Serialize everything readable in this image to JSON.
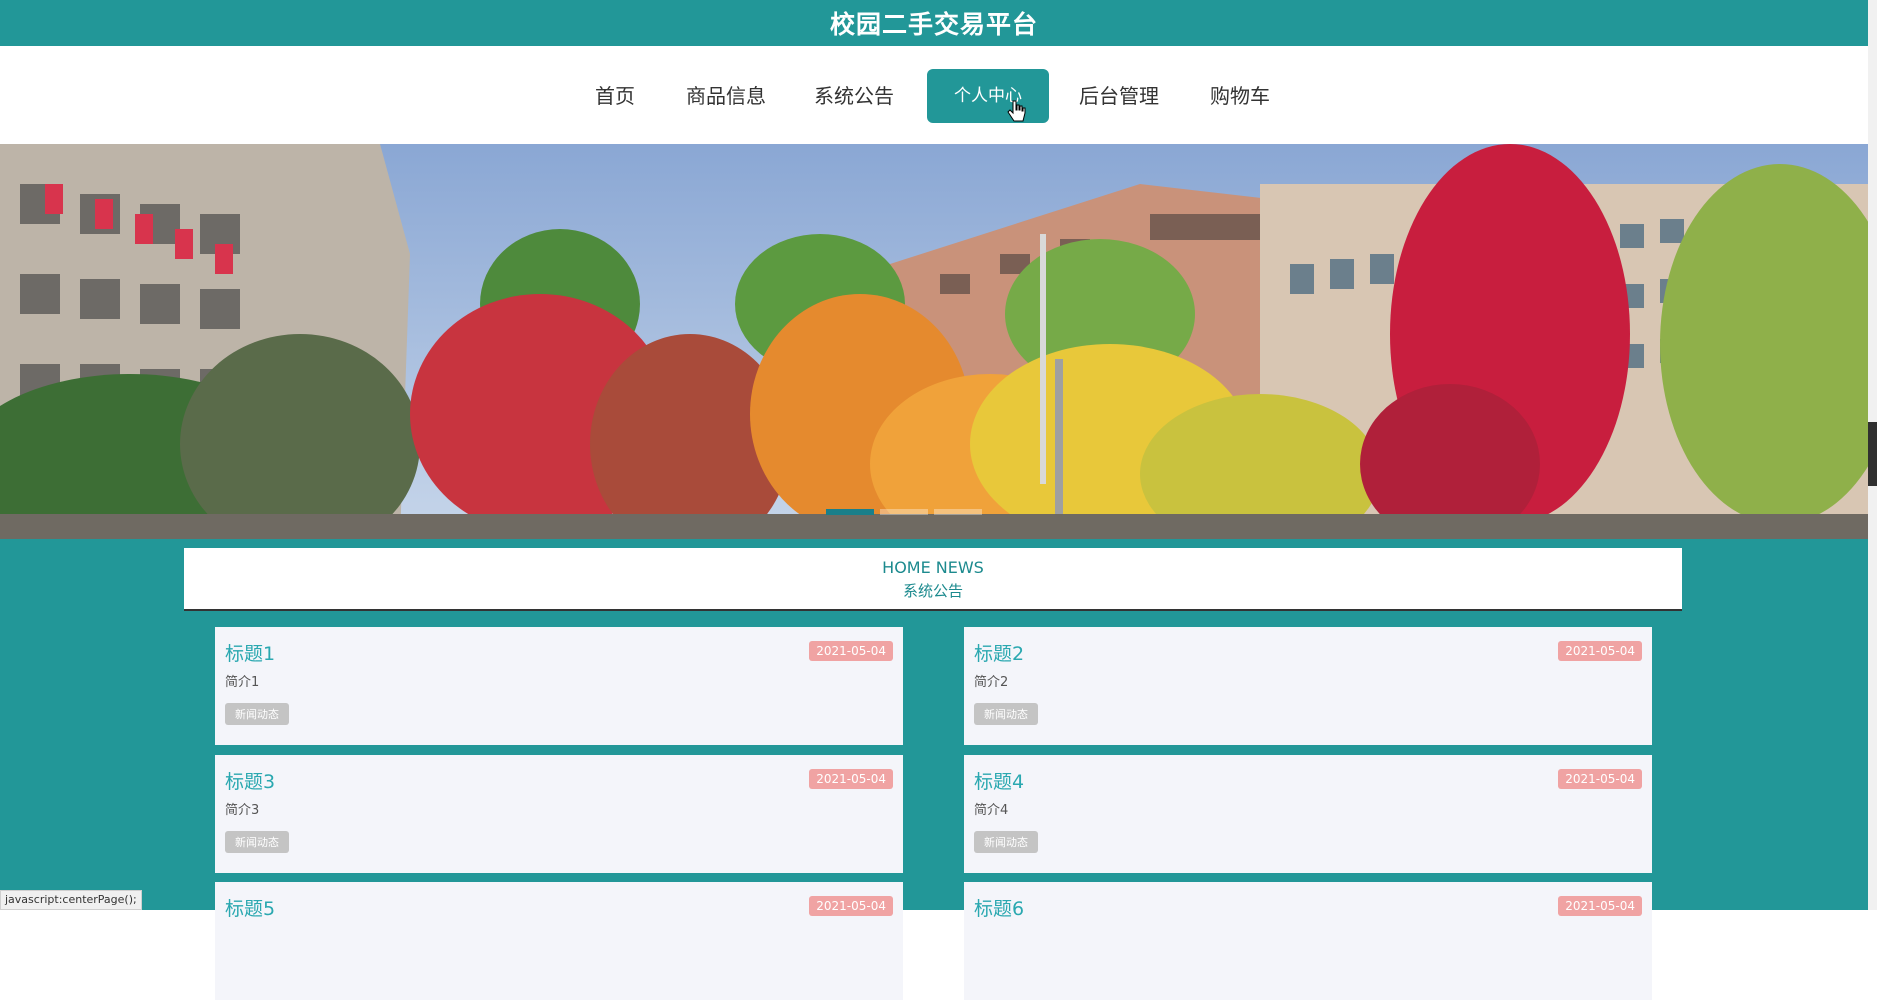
{
  "header": {
    "title": "校园二手交易平台"
  },
  "nav": {
    "items": [
      {
        "label": "首页"
      },
      {
        "label": "商品信息"
      },
      {
        "label": "系统公告"
      },
      {
        "label": "个人中心"
      },
      {
        "label": "后台管理"
      },
      {
        "label": "购物车"
      }
    ],
    "active_index": 3
  },
  "banner": {
    "slide_count": 3,
    "active_slide": 0
  },
  "news": {
    "header_en": "HOME NEWS",
    "header_cn": "系统公告",
    "cards": [
      {
        "title": "标题1",
        "date": "2021-05-04",
        "desc": "简介1",
        "tag": "新闻动态"
      },
      {
        "title": "标题2",
        "date": "2021-05-04",
        "desc": "简介2",
        "tag": "新闻动态"
      },
      {
        "title": "标题3",
        "date": "2021-05-04",
        "desc": "简介3",
        "tag": "新闻动态"
      },
      {
        "title": "标题4",
        "date": "2021-05-04",
        "desc": "简介4",
        "tag": "新闻动态"
      },
      {
        "title": "标题5",
        "date": "2021-05-04",
        "desc": "",
        "tag": ""
      },
      {
        "title": "标题6",
        "date": "2021-05-04",
        "desc": "",
        "tag": ""
      }
    ]
  },
  "status_bar": {
    "text": "javascript:centerPage();"
  },
  "colors": {
    "primary": "#229798",
    "date_badge": "#f0a3a3",
    "card_bg": "#f4f5fa",
    "title_text": "#2aa8b0"
  }
}
